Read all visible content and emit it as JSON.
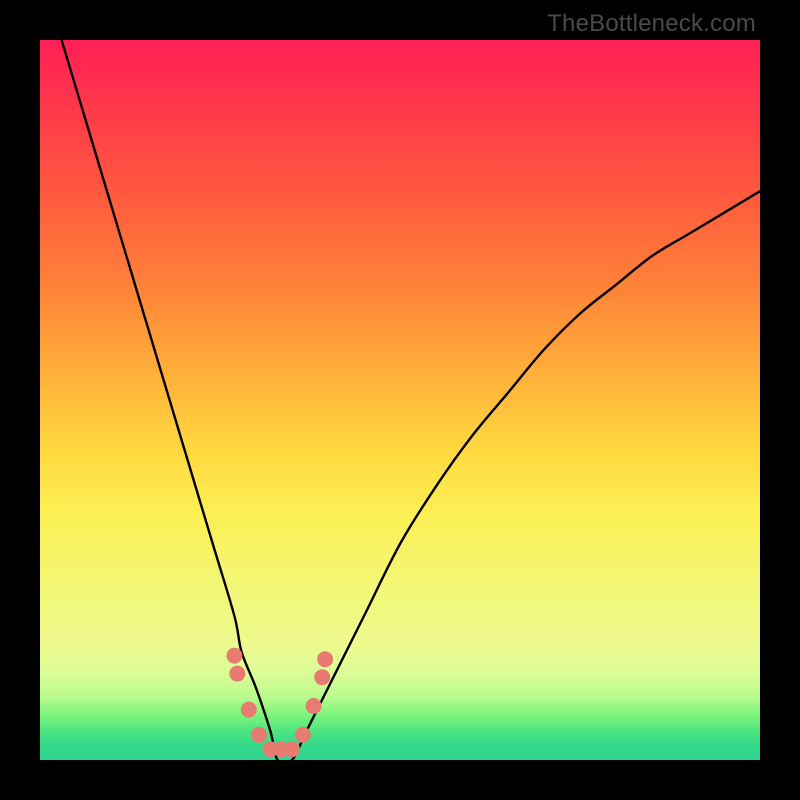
{
  "watermark": "TheBottleneck.com",
  "chart_data": {
    "type": "line",
    "title": "",
    "xlabel": "",
    "ylabel": "",
    "ylim": [
      0,
      100
    ],
    "xlim": [
      0,
      100
    ],
    "series": [
      {
        "name": "bottleneck-curve",
        "x": [
          3,
          6,
          9,
          12,
          15,
          18,
          21,
          24,
          27,
          28,
          30,
          32,
          33,
          35,
          37,
          40,
          45,
          50,
          55,
          60,
          65,
          70,
          75,
          80,
          85,
          90,
          95,
          100
        ],
        "values": [
          100,
          90,
          80,
          70,
          60,
          50,
          40,
          30,
          20,
          15,
          10,
          4,
          0,
          0,
          4,
          10,
          20,
          30,
          38,
          45,
          51,
          57,
          62,
          66,
          70,
          73,
          76,
          79
        ]
      }
    ],
    "markers": [
      {
        "x": 27.0,
        "y": 14.5
      },
      {
        "x": 27.4,
        "y": 12.0
      },
      {
        "x": 29.0,
        "y": 7.0
      },
      {
        "x": 30.4,
        "y": 3.5
      },
      {
        "x": 32.0,
        "y": 1.5
      },
      {
        "x": 33.5,
        "y": 1.5
      },
      {
        "x": 35.0,
        "y": 1.5
      },
      {
        "x": 36.5,
        "y": 3.5
      },
      {
        "x": 38.0,
        "y": 7.5
      },
      {
        "x": 39.2,
        "y": 11.5
      },
      {
        "x": 39.6,
        "y": 14.0
      }
    ],
    "marker_style": {
      "shape": "circle",
      "color": "#e77b72",
      "radius_px": 8
    }
  }
}
